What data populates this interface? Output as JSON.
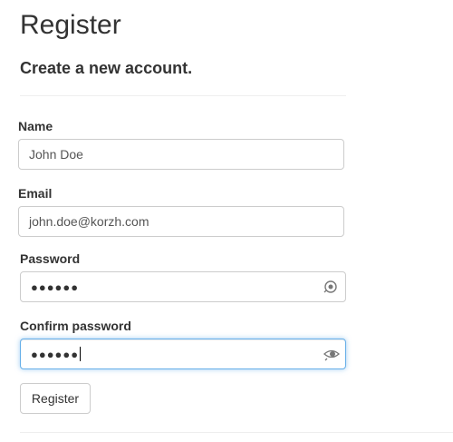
{
  "page": {
    "title": "Register",
    "subtitle": "Create a new account."
  },
  "form": {
    "name": {
      "label": "Name",
      "value": "John Doe"
    },
    "email": {
      "label": "Email",
      "value": "john.doe@korzh.com"
    },
    "password": {
      "label": "Password",
      "masked_value": "●●●●●●"
    },
    "confirm_password": {
      "label": "Confirm password",
      "masked_value": "●●●●●●"
    },
    "submit_label": "Register"
  },
  "colors": {
    "focus_border": "#66afe9",
    "input_border": "#cccccc"
  },
  "icons": {
    "password_reveal": "eye-reveal-icon"
  }
}
